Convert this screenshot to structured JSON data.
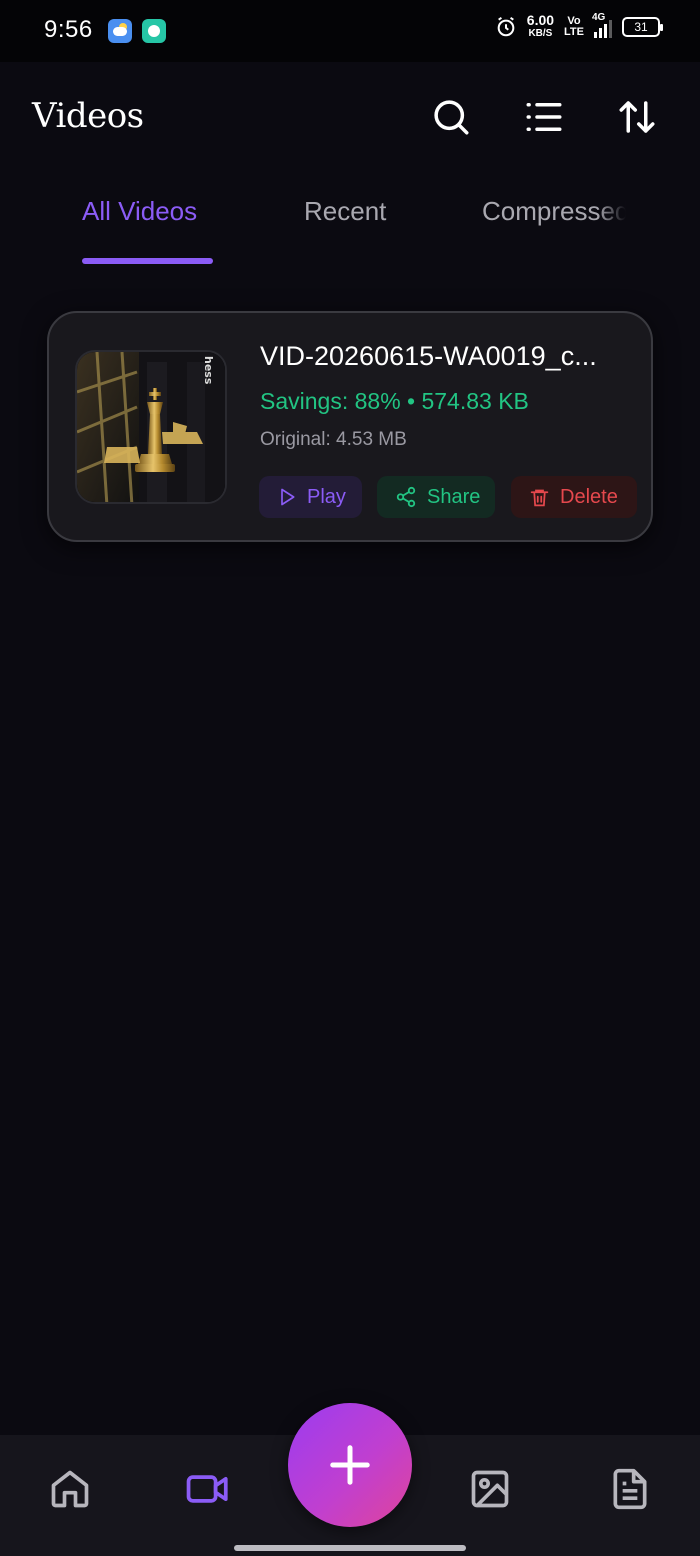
{
  "status_bar": {
    "time": "9:56",
    "speed_value": "6.00",
    "speed_unit": "KB/S",
    "volte_top": "Vo",
    "volte_bottom": "LTE",
    "network": "4G",
    "battery": "31",
    "icons": [
      "weather-icon",
      "chat-icon",
      "alarm-icon",
      "signal-icon",
      "battery-icon"
    ]
  },
  "header": {
    "title": "Videos",
    "icons": [
      "search-icon",
      "list-icon",
      "sort-icon"
    ]
  },
  "tabs": [
    {
      "label": "All Videos",
      "active": true
    },
    {
      "label": "Recent",
      "active": false
    },
    {
      "label": "Compressed",
      "active": false
    }
  ],
  "video": {
    "name": "VID-20260615-WA0019_c...",
    "savings": "Savings: 88% • 574.83 KB",
    "original": "Original: 4.53 MB",
    "thumb_text": "hess",
    "actions": {
      "play": "Play",
      "share": "Share",
      "delete": "Delete"
    }
  },
  "bottom_nav": {
    "items": [
      "home-icon",
      "video-icon",
      "add-icon",
      "image-icon",
      "document-icon"
    ],
    "active": "video-icon"
  },
  "colors": {
    "accent": "#8b5cf6",
    "success": "#22c483",
    "danger": "#e5484d",
    "background": "#0b0a11"
  }
}
